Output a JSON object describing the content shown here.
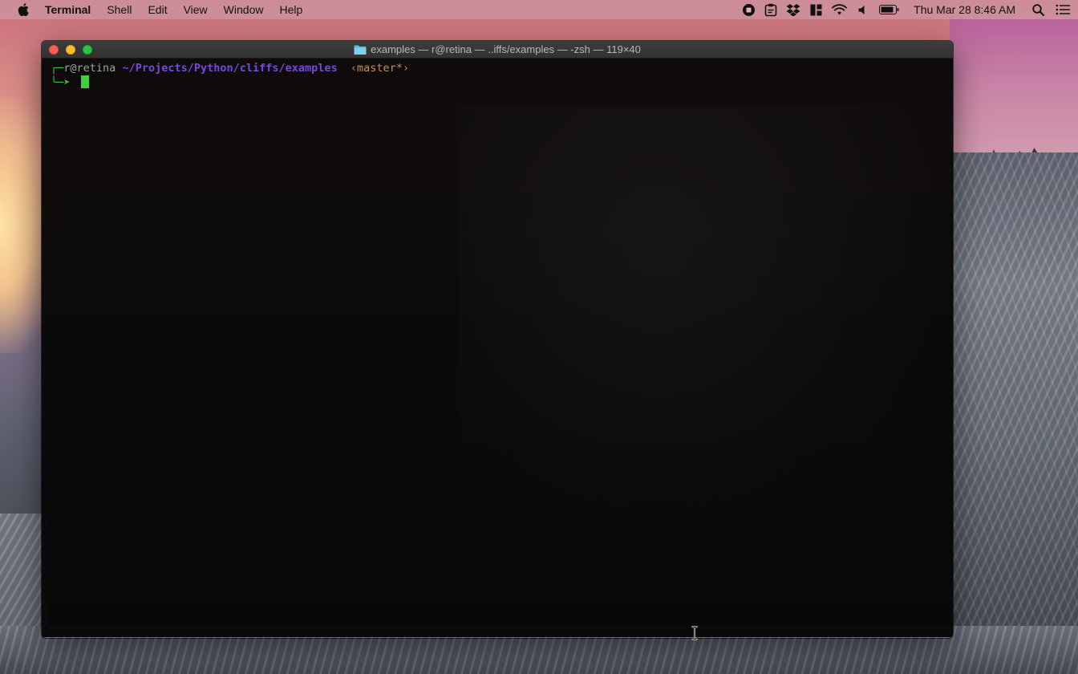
{
  "menubar": {
    "app_name": "Terminal",
    "menus": [
      "Shell",
      "Edit",
      "View",
      "Window",
      "Help"
    ],
    "clock": "Thu Mar 28  8:46 AM",
    "status_icons": [
      "record-icon",
      "clipboard-icon",
      "dropbox-icon",
      "window-icon",
      "wifi-icon",
      "volume-icon",
      "battery-icon",
      "search-icon",
      "list-icon"
    ]
  },
  "window": {
    "title": "examples — r@retina — ..iffs/examples — -zsh — 119×40",
    "title_icon": "folder-icon"
  },
  "terminal": {
    "prompt_corner_top": "┌─",
    "user_host": "r@retina",
    "cwd": "~/Projects/Python/cliffs/examples",
    "git_branch": "‹master*›",
    "prompt_corner_bottom": "╰─➤"
  },
  "colors": {
    "prompt_green": "#3ec53e",
    "path_purple": "#7648e0",
    "git_orange": "#c29057",
    "terminal_bg": "#060606"
  }
}
